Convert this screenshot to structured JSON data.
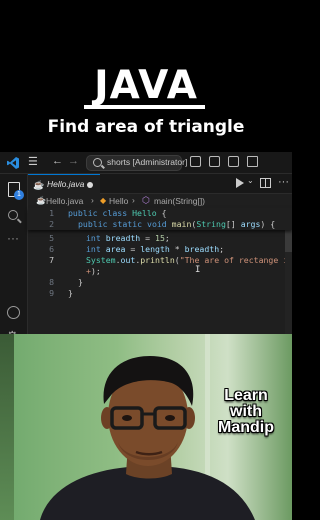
{
  "overlay": {
    "title": "JAVA",
    "subtitle": "Find area of triangle"
  },
  "vscode": {
    "search_text": "shorts [Administrator]",
    "activity_badge": "1",
    "tab": {
      "label": "Hello.java",
      "dirty": true
    },
    "breadcrumb": [
      "Hello.java",
      "Hello",
      "main(String[])"
    ],
    "icons": [
      "vscode-logo-icon",
      "menu-icon",
      "back-arrow-icon",
      "forward-arrow-icon",
      "search-icon",
      "layout-sidebar-icon",
      "layout-panel-icon",
      "layout-secondary-icon",
      "layout-customize-icon",
      "explorer-icon",
      "search-icon",
      "more-icon",
      "account-icon",
      "gear-icon",
      "run-icon",
      "split-editor-icon",
      "more-actions-icon"
    ],
    "code_lines": [
      {
        "n": "1",
        "text": "public class Hello {"
      },
      {
        "n": "2",
        "text": "public static void main(String[] args) {"
      },
      {
        "n": "5",
        "text": "int breadth = 15;"
      },
      {
        "n": "6",
        "text": "int area = length * breadth;"
      },
      {
        "n": "7",
        "text": "System.out.println(\"The are of rectange is"
      },
      {
        "n": "",
        "text": "+);"
      },
      {
        "n": "8",
        "text": "}"
      },
      {
        "n": "9",
        "text": "}"
      }
    ],
    "active_line": "7"
  },
  "video": {
    "brand_lines": [
      "Learn",
      "with",
      "Mandip"
    ]
  }
}
